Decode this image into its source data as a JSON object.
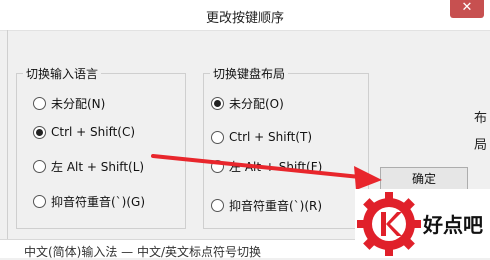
{
  "window": {
    "title": "更改按键顺序",
    "close_glyph": "✕"
  },
  "input_language_group": {
    "legend": "切换输入语言",
    "options": [
      {
        "label": "未分配(N)",
        "checked": false
      },
      {
        "label": "Ctrl + Shift(C)",
        "checked": true
      },
      {
        "label": "左 Alt + Shift(L)",
        "checked": false
      },
      {
        "label": "抑音符重音(`)(G)",
        "checked": false
      }
    ]
  },
  "keyboard_layout_group": {
    "legend": "切换键盘布局",
    "options": [
      {
        "label": "未分配(O)",
        "checked": true
      },
      {
        "label": "Ctrl + Shift(T)",
        "checked": false
      },
      {
        "label": "左 Alt + Shift(F)",
        "checked": false
      },
      {
        "label": "抑音符重音(`)(R)",
        "checked": false
      }
    ]
  },
  "buttons": {
    "ok_label": "确定"
  },
  "side_texts": [
    "布",
    "局"
  ],
  "background_text": "中文(简体)输入法 — 中文/英文标点符号切换",
  "watermark": {
    "text": "好点吧",
    "colors": {
      "accent": "#e0202a"
    }
  },
  "colors": {
    "arrow": "#e8262c",
    "close": "#c75050"
  }
}
